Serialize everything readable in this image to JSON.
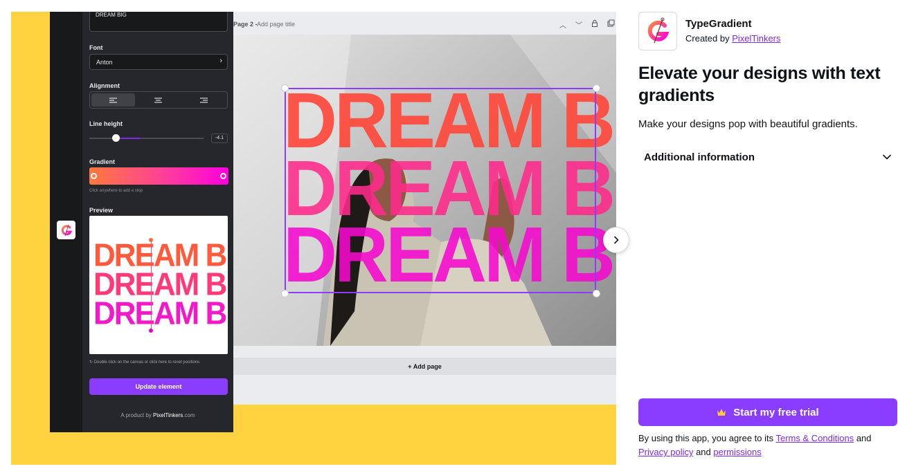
{
  "editor": {
    "text_value": "DREAM BIG",
    "font_label": "Font",
    "font_value": "Anton",
    "alignment_label": "Alignment",
    "line_height_label": "Line height",
    "line_height_value": "-4.1",
    "gradient_label": "Gradient",
    "gradient_hint": "Click anywhere to add a stop",
    "gradient_colors": [
      "#ff7a3d",
      "#ff3d9a",
      "#ff00dd"
    ],
    "preview_label": "Preview",
    "preview_lines": [
      "DREAM BIG",
      "DREAM BIG",
      "DREAM BIG"
    ],
    "reset_hint": "Double click on the canvas or click here to reset positions",
    "update_button": "Update element",
    "product_by_prefix": "A product by ",
    "product_by_brand": "PixelTinkers",
    "product_by_suffix": ".com"
  },
  "canvas": {
    "page_number": "Page 2 -",
    "page_title_placeholder": "Add page title",
    "design_lines": [
      "DREAM BIG",
      "DREAM BIG",
      "DREAM BIG"
    ],
    "add_page": "+ Add page"
  },
  "app": {
    "name": "TypeGradient",
    "created_by_prefix": "Created by ",
    "creator": "PixelTinkers",
    "headline": "Elevate your designs with text gradients",
    "tagline": "Make your designs pop with beautiful gradients.",
    "additional_info": "Additional information",
    "cta": "Start my free trial",
    "legal_prefix": "By using this app, you agree to its ",
    "terms": "Terms & Conditions",
    "and1": " and",
    "privacy": "Privacy policy",
    "and2": " and ",
    "permissions": "permissions",
    "accent_color": "#8b3dff",
    "promo_background": "#ffd23f"
  }
}
